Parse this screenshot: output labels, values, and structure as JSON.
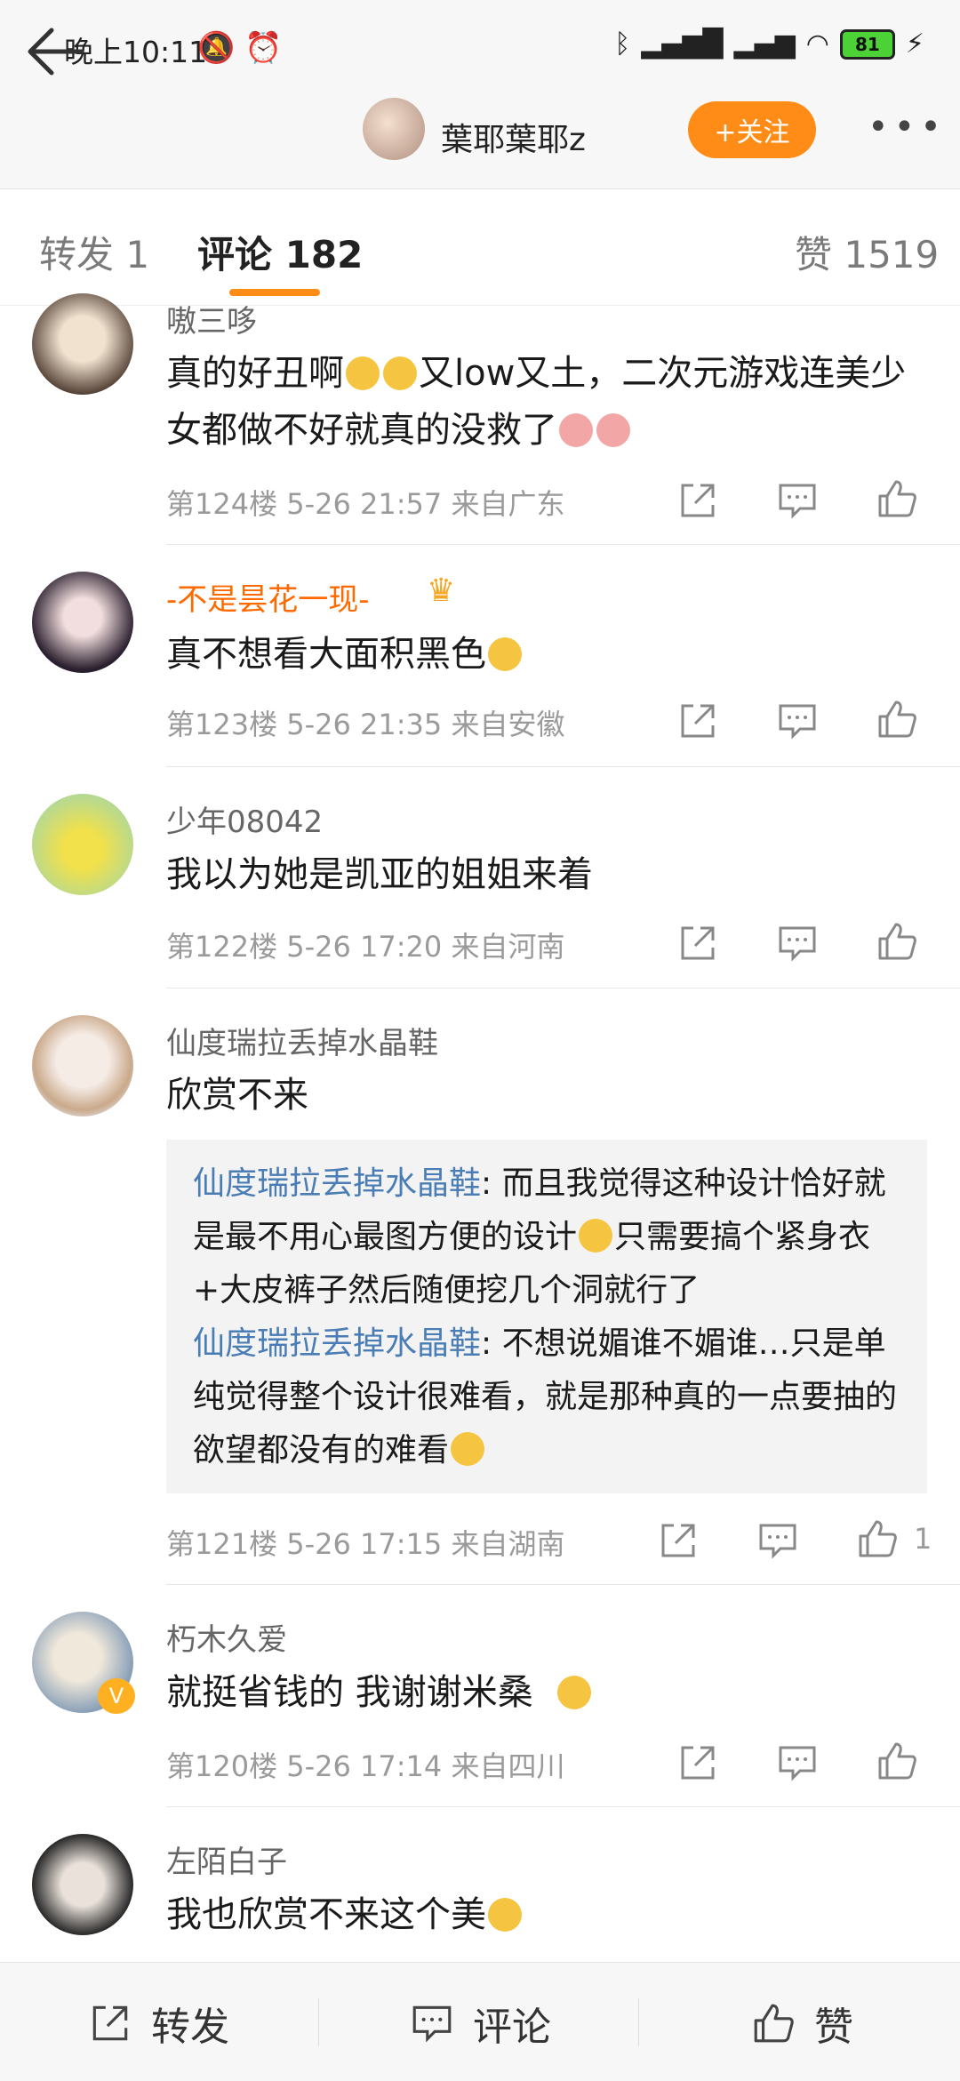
{
  "status_bar": {
    "time": "晚上10:11",
    "battery": "81",
    "left_icons": "🔕 ⏰"
  },
  "header": {
    "username": "葉耶葉耶z",
    "follow_label": "+关注",
    "more_label": "•••"
  },
  "tabs": {
    "repost": "转发 1",
    "comments": "评论 182",
    "likes": "赞 1519"
  },
  "comments": [
    {
      "user": "嗷三哆",
      "text_a": "真的好丑啊",
      "text_b": "又low又土，二次元游戏连美少女都做不好就真的没救了",
      "meta": "第124楼 5-26 21:57 来自广东"
    },
    {
      "user": "-不是昙花一现-",
      "text": "真不想看大面积黑色",
      "meta": "第123楼 5-26 21:35 来自安徽"
    },
    {
      "user": "少年08042",
      "text": "我以为她是凯亚的姐姐来着",
      "meta": "第122楼 5-26 17:20 来自河南"
    },
    {
      "user": "仙度瑞拉丢掉水晶鞋",
      "text": "欣赏不来",
      "meta": "第121楼 5-26 17:15 来自湖南",
      "likes": "1",
      "replies": [
        {
          "name": "仙度瑞拉丢掉水晶鞋",
          "text": ": 而且我觉得这种设计恰好就是最不用心最图方便的设计",
          "text_tail": "只需要搞个紧身衣+大皮裤子然后随便挖几个洞就行了"
        },
        {
          "name": "仙度瑞拉丢掉水晶鞋",
          "text": ": 不想说媚谁不媚谁…只是单纯觉得整个设计很难看，就是那种真的一点要抽的欲望都没有的难看"
        }
      ]
    },
    {
      "user": "朽木久爱",
      "text": "就挺省钱的 我谢谢米桑",
      "meta": "第120楼 5-26 17:14 来自四川",
      "badge": "V"
    },
    {
      "user": "左陌白子",
      "text": "我也欣赏不来这个美"
    }
  ],
  "bottom_bar": {
    "repost": "转发",
    "comment": "评论",
    "like": "赞"
  },
  "colors": {
    "accent": "#ff8c17",
    "reply_name": "#4a7db5",
    "username_orange": "#ff6a00"
  }
}
